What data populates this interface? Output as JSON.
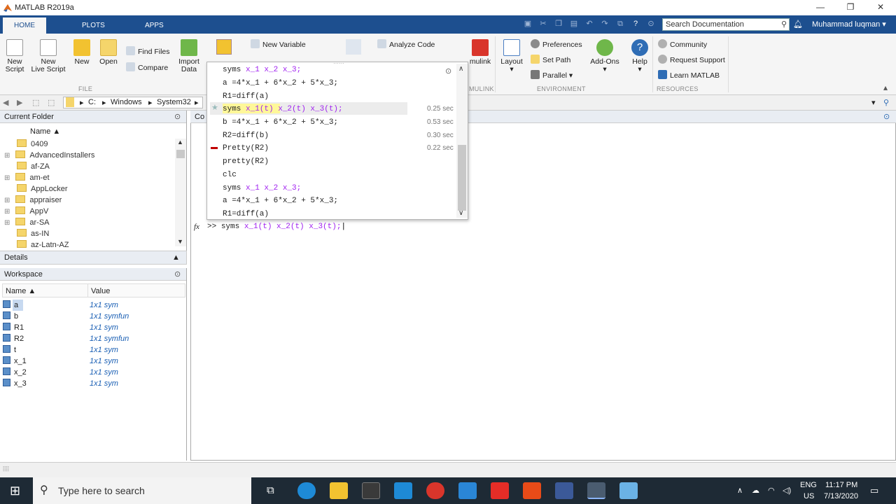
{
  "window": {
    "title": "MATLAB R2019a",
    "min": "—",
    "max": "❐",
    "close": "✕"
  },
  "tabs": [
    {
      "label": "HOME"
    },
    {
      "label": "PLOTS"
    },
    {
      "label": "APPS"
    }
  ],
  "search": {
    "placeholder": "Search Documentation"
  },
  "user": "Muhammad luqman ▾",
  "ribbon": {
    "new_script": "New\nScript",
    "new_live_script": "New\nLive Script",
    "new": "New",
    "open": "Open",
    "find_files": "Find Files",
    "compare": "Compare",
    "import_data": "Import\nData",
    "new_variable": "New Variable",
    "analyze_code": "Analyze Code",
    "simulink": "mulink",
    "layout": "Layout",
    "preferences": "Preferences",
    "set_path": "Set Path",
    "parallel": "Parallel ▾",
    "addons": "Add-Ons",
    "help": "Help",
    "community": "Community",
    "request_support": "Request Support",
    "learn_matlab": "Learn MATLAB",
    "sections": {
      "file": "FILE",
      "simulink": "MULINK",
      "environment": "ENVIRONMENT",
      "resources": "RESOURCES"
    }
  },
  "address": {
    "crumbs": [
      "C:",
      "Windows",
      "System32"
    ]
  },
  "current_folder": {
    "title": "Current Folder",
    "name_col": "Name ▲",
    "items": [
      {
        "name": "0409",
        "expandable": false
      },
      {
        "name": "AdvancedInstallers",
        "expandable": true
      },
      {
        "name": "af-ZA",
        "expandable": false
      },
      {
        "name": "am-et",
        "expandable": true
      },
      {
        "name": "AppLocker",
        "expandable": false
      },
      {
        "name": "appraiser",
        "expandable": true
      },
      {
        "name": "AppV",
        "expandable": true
      },
      {
        "name": "ar-SA",
        "expandable": true
      },
      {
        "name": "as-IN",
        "expandable": false
      },
      {
        "name": "az-Latn-AZ",
        "expandable": false
      }
    ]
  },
  "details": {
    "title": "Details"
  },
  "workspace": {
    "title": "Workspace",
    "name_col": "Name ▲",
    "value_col": "Value",
    "rows": [
      {
        "name": "a",
        "value": "1x1 sym"
      },
      {
        "name": "b",
        "value": "1x1 symfun"
      },
      {
        "name": "R1",
        "value": "1x1 sym"
      },
      {
        "name": "R2",
        "value": "1x1 symfun"
      },
      {
        "name": "t",
        "value": "1x1 sym"
      },
      {
        "name": "x_1",
        "value": "1x1 sym"
      },
      {
        "name": "x_2",
        "value": "1x1 sym"
      },
      {
        "name": "x_3",
        "value": "1x1 sym"
      }
    ]
  },
  "command_window": {
    "title": "Co",
    "prompt": ">>",
    "command_kw": "syms",
    "command_args": "x_1(t) x_2(t) x_3(t);"
  },
  "history": [
    {
      "kw": "syms",
      "args": "x_1 x_2 x_3;",
      "plain": "",
      "time": ""
    },
    {
      "kw": "",
      "args": "",
      "plain": "a =4*x_1 + 6*x_2 + 5*x_3;",
      "time": ""
    },
    {
      "kw": "",
      "args": "",
      "plain": "R1=diff(a)",
      "time": ""
    },
    {
      "kw": "syms",
      "args": "x_1(t) x_2(t) x_3(t);",
      "plain": "",
      "time": "0.25 sec"
    },
    {
      "kw": "",
      "args": "",
      "plain": "b =4*x_1 + 6*x_2 + 5*x_3;",
      "time": "0.53 sec"
    },
    {
      "kw": "",
      "args": "",
      "plain": "R2=diff(b)",
      "time": "0.30 sec"
    },
    {
      "kw": "",
      "args": "",
      "plain": "Pretty(R2)",
      "time": "0.22 sec"
    },
    {
      "kw": "",
      "args": "",
      "plain": "pretty(R2)",
      "time": ""
    },
    {
      "kw": "",
      "args": "",
      "plain": "clc",
      "time": ""
    },
    {
      "kw": "syms",
      "args": "x_1 x_2 x_3;",
      "plain": "",
      "time": ""
    },
    {
      "kw": "",
      "args": "",
      "plain": "a =4*x_1 + 6*x_2 + 5*x_3;",
      "time": ""
    },
    {
      "kw": "",
      "args": "",
      "plain": "R1=diff(a)",
      "time": ""
    }
  ],
  "taskbar": {
    "search": "Type here to search",
    "lang1": "ENG",
    "lang2": "US",
    "time": "11:17 PM",
    "date": "7/13/2020"
  },
  "colors": {
    "accent": "#1d4f8f",
    "keyword_arg": "#a020f0",
    "error": "#c00000"
  }
}
